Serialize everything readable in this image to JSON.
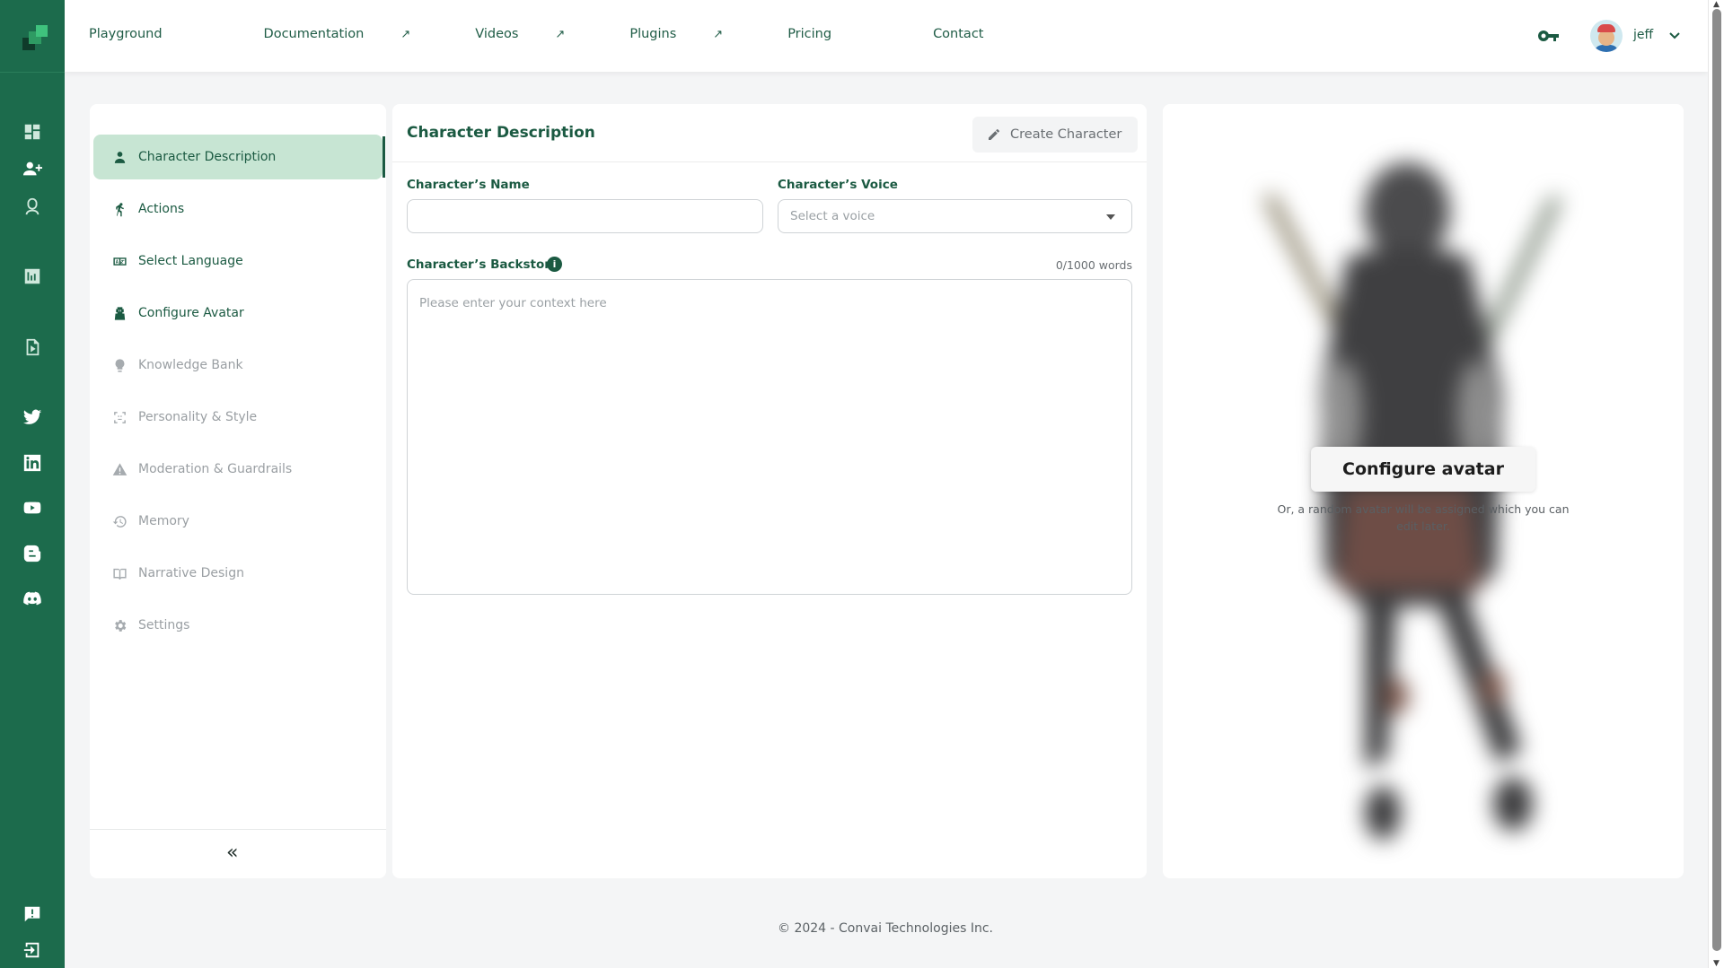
{
  "nav": {
    "items": [
      {
        "label": "Playground",
        "external": ""
      },
      {
        "label": "Documentation",
        "external": "↗"
      },
      {
        "label": "Videos",
        "external": "↗"
      },
      {
        "label": "Plugins",
        "external": "↗"
      },
      {
        "label": "Pricing",
        "external": ""
      },
      {
        "label": "Contact",
        "external": ""
      }
    ]
  },
  "user": {
    "name": "jeff"
  },
  "sidebar": {
    "items": [
      {
        "label": "Character Description",
        "icon": "person-icon",
        "state": "active"
      },
      {
        "label": "Actions",
        "icon": "running-icon",
        "state": "enabled"
      },
      {
        "label": "Select Language",
        "icon": "language-icon",
        "state": "enabled"
      },
      {
        "label": "Configure Avatar",
        "icon": "avatar-icon",
        "state": "enabled"
      },
      {
        "label": "Knowledge Bank",
        "icon": "lightbulb-icon",
        "state": "disabled"
      },
      {
        "label": "Personality & Style",
        "icon": "face-scan-icon",
        "state": "disabled"
      },
      {
        "label": "Moderation & Guardrails",
        "icon": "warning-icon",
        "state": "disabled"
      },
      {
        "label": "Memory",
        "icon": "history-icon",
        "state": "disabled"
      },
      {
        "label": "Narrative Design",
        "icon": "book-icon",
        "state": "disabled"
      },
      {
        "label": "Settings",
        "icon": "gear-icon",
        "state": "disabled"
      }
    ],
    "collapse_label": "«"
  },
  "main": {
    "title": "Character Description",
    "create_button": "Create Character",
    "name_label": "Character’s Name",
    "name_value": "",
    "voice_label": "Character’s Voice",
    "voice_placeholder": "Select a voice",
    "backstory_label": "Character’s Backstory",
    "backstory_info": "i",
    "word_count": "0/1000 words",
    "backstory_placeholder": "Please enter your context here"
  },
  "avatar_panel": {
    "button": "Configure avatar",
    "note": "Or, a random avatar will be assigned which you can edit later."
  },
  "footer": {
    "copyright": "© 2024 - Convai Technologies Inc."
  },
  "colors": {
    "brand_green": "#1c6b4c",
    "accent_dark": "#1b5a42",
    "active_bg": "#c7e5d3"
  }
}
